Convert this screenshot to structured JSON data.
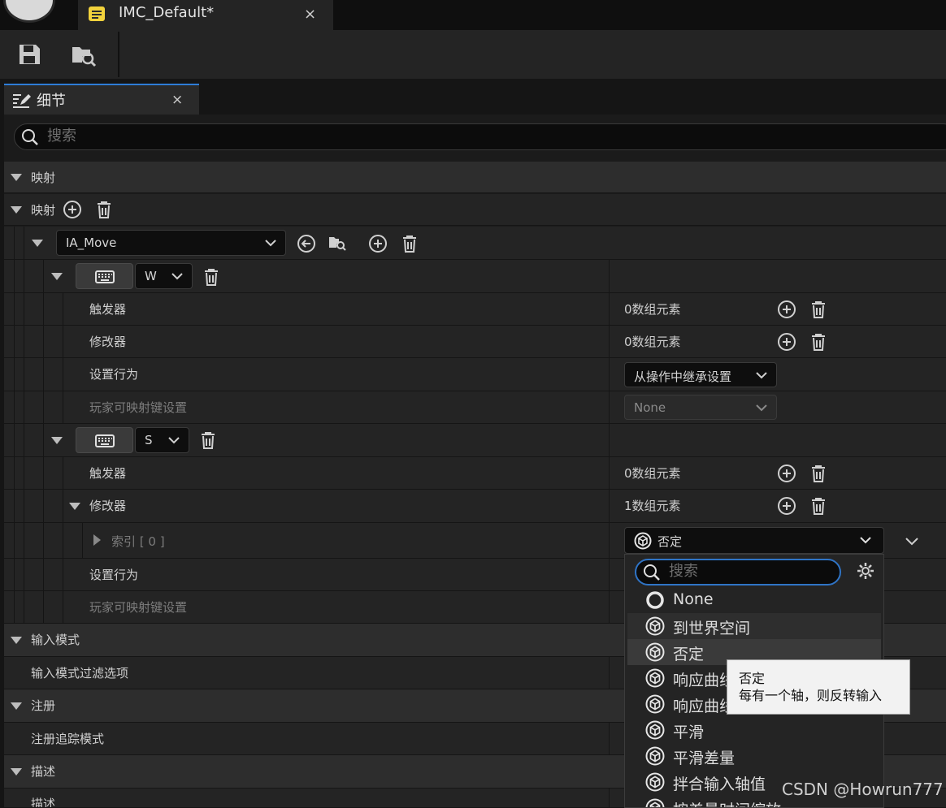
{
  "tab": {
    "title": "IMC_Default*",
    "close": "×"
  },
  "details_tab": {
    "label": "细节",
    "close": "×"
  },
  "search": {
    "placeholder": "搜索"
  },
  "sections": {
    "mapping_header": "映射",
    "mapping_array": "映射",
    "input_mode": "输入模式",
    "input_mode_filter": "输入模式过滤选项",
    "registration": "注册",
    "registration_tracking": "注册追踪模式",
    "description": "描述",
    "description_field": "描述"
  },
  "action": {
    "name": "IA_Move"
  },
  "mappings": [
    {
      "key": "W",
      "triggers_label": "触发器",
      "triggers_value": "0数组元素",
      "modifiers_label": "修改器",
      "modifiers_value": "0数组元素",
      "settings_behavior_label": "设置行为",
      "settings_behavior_value": "从操作中继承设置",
      "player_mappable_label": "玩家可映射键设置",
      "player_mappable_value": "None"
    },
    {
      "key": "S",
      "triggers_label": "触发器",
      "triggers_value": "0数组元素",
      "modifiers_label": "修改器",
      "modifiers_value": "1数组元素",
      "index_label": "索引 [ 0 ]",
      "index_value": "否定",
      "settings_behavior_label": "设置行为",
      "player_mappable_label": "玩家可映射键设置"
    }
  ],
  "popup": {
    "search_placeholder": "搜索",
    "options": [
      "None",
      "到世界空间",
      "否定",
      "响应曲线",
      "响应曲线",
      "平滑",
      "平滑差量",
      "拌合输入轴值",
      "按差量时间缩放"
    ],
    "hovered": "到世界空间",
    "selected": "否定"
  },
  "tooltip": {
    "title": "否定",
    "body": "每有一个轴，则反转输入"
  },
  "watermark": "CSDN @Howrun777",
  "colors": {
    "accent": "#2e7dd7",
    "background": "#151515",
    "row": "#242424",
    "tooltip_bg": "#f2f2f2"
  }
}
